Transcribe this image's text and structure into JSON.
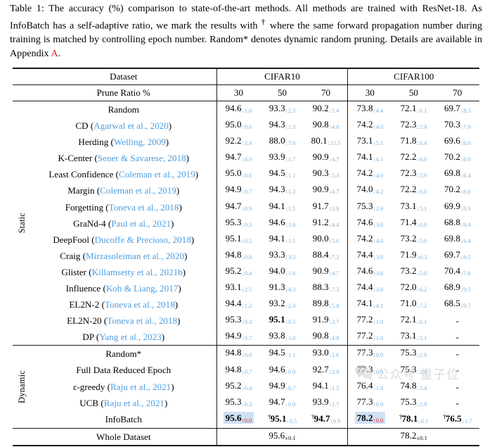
{
  "caption": {
    "label": "Table 1:",
    "text_1": " The accuracy (%) comparison to state-of-the-art methods. All methods are trained with ResNet-18. As InfoBatch has a self-adaptive ratio, we mark the results with ",
    "dagger": "†",
    "text_2": " where the same forward propagation number during training is matched by controlling epoch number. Random* denotes dynamic random pruning. Details are available in Appendix ",
    "appendix_link": "A",
    "text_3": "."
  },
  "table": {
    "header": {
      "dataset_label": "Dataset",
      "prune_ratio_label": "Prune Ratio %",
      "groups": [
        "CIFAR10",
        "CIFAR100"
      ],
      "ratios": [
        "30",
        "50",
        "70",
        "30",
        "50",
        "70"
      ]
    },
    "side_labels": {
      "static": "Static",
      "dynamic": "Dynamic"
    },
    "static_rows": [
      {
        "name": "Random",
        "cite": "",
        "year": "",
        "cells": [
          {
            "v": "94.6",
            "s": "↓1.0",
            "d": "down"
          },
          {
            "v": "93.3",
            "s": "↓2.3",
            "d": "down"
          },
          {
            "v": "90.2",
            "s": "↓5.4",
            "d": "down"
          },
          {
            "v": "73.8",
            "s": "↓4.4",
            "d": "down"
          },
          {
            "v": "72.1",
            "s": "↓6.1",
            "d": "down"
          },
          {
            "v": "69.7",
            "s": "↓8.5",
            "d": "down"
          }
        ]
      },
      {
        "name": "CD",
        "cite": "Agarwal et al., 2020",
        "year": "",
        "cells": [
          {
            "v": "95.0",
            "s": "↓0.6",
            "d": "down"
          },
          {
            "v": "94.3",
            "s": "↓1.3",
            "d": "down"
          },
          {
            "v": "90.8",
            "s": "↓4.8",
            "d": "down"
          },
          {
            "v": "74.2",
            "s": "↓4.0",
            "d": "down"
          },
          {
            "v": "72.3",
            "s": "↓5.9",
            "d": "down"
          },
          {
            "v": "70.3",
            "s": "↓7.9",
            "d": "down"
          }
        ]
      },
      {
        "name": "Herding",
        "cite": "Welling, 2009",
        "year": "",
        "cells": [
          {
            "v": "92.2",
            "s": "↓3.4",
            "d": "down"
          },
          {
            "v": "88.0",
            "s": "↓7.6",
            "d": "down"
          },
          {
            "v": "80.1",
            "s": "↓15.5",
            "d": "down"
          },
          {
            "v": "73.1",
            "s": "↓5.1",
            "d": "down"
          },
          {
            "v": "71.8",
            "s": "↓6.4",
            "d": "down"
          },
          {
            "v": "69.6",
            "s": "↓8.0",
            "d": "down"
          }
        ]
      },
      {
        "name": "K-Center",
        "cite": "Sener & Savarese, 2018",
        "year": "",
        "cells": [
          {
            "v": "94.7",
            "s": "↓0.9",
            "d": "down"
          },
          {
            "v": "93.9",
            "s": "↓1.7",
            "d": "down"
          },
          {
            "v": "90.9",
            "s": "↓4.7",
            "d": "down"
          },
          {
            "v": "74.1",
            "s": "↓4.1",
            "d": "down"
          },
          {
            "v": "72.2",
            "s": "↓6.0",
            "d": "down"
          },
          {
            "v": "70.2",
            "s": "↓8.0",
            "d": "down"
          }
        ]
      },
      {
        "name": "Least Confidence",
        "cite": "Coleman et al., 2019",
        "year": "",
        "cells": [
          {
            "v": "95.0",
            "s": "↓0.6",
            "d": "down"
          },
          {
            "v": "94.5",
            "s": "↓1.1",
            "d": "down"
          },
          {
            "v": "90.3",
            "s": "↓5.3",
            "d": "down"
          },
          {
            "v": "74.2",
            "s": "↓4.0",
            "d": "down"
          },
          {
            "v": "72.3",
            "s": "↓5.9",
            "d": "down"
          },
          {
            "v": "69.8",
            "s": "↓8.4",
            "d": "down"
          }
        ]
      },
      {
        "name": "Margin",
        "cite": "Coleman et al., 2019",
        "year": "",
        "cells": [
          {
            "v": "94.9",
            "s": "↓0.7",
            "d": "down"
          },
          {
            "v": "94.3",
            "s": "↓1.3",
            "d": "down"
          },
          {
            "v": "90.9",
            "s": "↓4.7",
            "d": "down"
          },
          {
            "v": "74.0",
            "s": "↓4.2",
            "d": "down"
          },
          {
            "v": "72.2",
            "s": "↓6.0",
            "d": "down"
          },
          {
            "v": "70.2",
            "s": "↓8.0",
            "d": "down"
          }
        ]
      },
      {
        "name": "Forgetting",
        "cite": "Toneva et al., 2018",
        "year": "",
        "cells": [
          {
            "v": "94.7",
            "s": "↓0.9",
            "d": "down"
          },
          {
            "v": "94.1",
            "s": "↓1.5",
            "d": "down"
          },
          {
            "v": "91.7",
            "s": "↓3.9",
            "d": "down"
          },
          {
            "v": "75.3",
            "s": "↓2.9",
            "d": "down"
          },
          {
            "v": "73.1",
            "s": "↓5.1",
            "d": "down"
          },
          {
            "v": "69.9",
            "s": "↓8.3",
            "d": "down"
          }
        ]
      },
      {
        "name": "GraNd-4",
        "cite": "Paul et al., 2021",
        "year": "",
        "cells": [
          {
            "v": "95.3",
            "s": "↓0.3",
            "d": "down"
          },
          {
            "v": "94.6",
            "s": "↓1.0",
            "d": "down"
          },
          {
            "v": "91.2",
            "s": "↓4.4",
            "d": "down"
          },
          {
            "v": "74.6",
            "s": "↓3.6",
            "d": "down"
          },
          {
            "v": "71.4",
            "s": "↓6.8",
            "d": "down"
          },
          {
            "v": "68.8",
            "s": "↓9.4",
            "d": "down"
          }
        ]
      },
      {
        "name": "DeepFool",
        "cite": "Ducoffe & Precioso, 2018",
        "year": "",
        "cells": [
          {
            "v": "95.1",
            "s": "↓0.5",
            "d": "down"
          },
          {
            "v": "94.1",
            "s": "↓1.5",
            "d": "down"
          },
          {
            "v": "90.0",
            "s": "↓5.6",
            "d": "down"
          },
          {
            "v": "74.2",
            "s": "↓4.0",
            "d": "down"
          },
          {
            "v": "73.2",
            "s": "↓5.0",
            "d": "down"
          },
          {
            "v": "69.8",
            "s": "↓6.4",
            "d": "down"
          }
        ]
      },
      {
        "name": "Craig",
        "cite": "Mirzasoleiman et al., 2020",
        "year": "",
        "cells": [
          {
            "v": "94.8",
            "s": "↓0.8",
            "d": "down"
          },
          {
            "v": "93.3",
            "s": "↓3.3",
            "d": "down"
          },
          {
            "v": "88.4",
            "s": "↓7.2",
            "d": "down"
          },
          {
            "v": "74.4",
            "s": "↓3.8",
            "d": "down"
          },
          {
            "v": "71.9",
            "s": "↓6.3",
            "d": "down"
          },
          {
            "v": "69.7",
            "s": "↓8.5",
            "d": "down"
          }
        ]
      },
      {
        "name": "Glister",
        "cite": "Killamsetty et al., 2021b",
        "year": "",
        "cells": [
          {
            "v": "95.2",
            "s": "↓0.4",
            "d": "down"
          },
          {
            "v": "94.0",
            "s": "↓1.6",
            "d": "down"
          },
          {
            "v": "90.9",
            "s": "↓4.7",
            "d": "down"
          },
          {
            "v": "74.6",
            "s": "↓3.6",
            "d": "down"
          },
          {
            "v": "73.2",
            "s": "↓5.0",
            "d": "down"
          },
          {
            "v": "70.4",
            "s": "↓7.8",
            "d": "down"
          }
        ]
      },
      {
        "name": "Influence",
        "cite": "Koh & Liang, 2017",
        "year": "",
        "cells": [
          {
            "v": "93.1",
            "s": "↓2.5",
            "d": "down"
          },
          {
            "v": "91.3",
            "s": "↓4.3",
            "d": "down"
          },
          {
            "v": "88.3",
            "s": "↓7.3",
            "d": "down"
          },
          {
            "v": "74.4",
            "s": "↓3.8",
            "d": "down"
          },
          {
            "v": "72.0",
            "s": "↓6.2",
            "d": "down"
          },
          {
            "v": "68.9",
            "s": "↓9.5",
            "d": "down"
          }
        ]
      },
      {
        "name": "EL2N-2",
        "cite": "Toneva et al., 2018",
        "year": "",
        "cells": [
          {
            "v": "94.4",
            "s": "↓1.2",
            "d": "down"
          },
          {
            "v": "93.2",
            "s": "↓2.4",
            "d": "down"
          },
          {
            "v": "89.8",
            "s": "↓5.8",
            "d": "down"
          },
          {
            "v": "74.1",
            "s": "↓4.1",
            "d": "down"
          },
          {
            "v": "71.0",
            "s": "↓7.2",
            "d": "down"
          },
          {
            "v": "68.5",
            "s": "↓9.7",
            "d": "down"
          }
        ]
      },
      {
        "name": "EL2N-20",
        "cite": "Toneva et al., 2018",
        "year": "",
        "cells": [
          {
            "v": "95.3",
            "s": "↓0.3",
            "d": "down"
          },
          {
            "v": "95.1",
            "s": "↓0.5",
            "d": "down",
            "bold": true
          },
          {
            "v": "91.9",
            "s": "↓3.7",
            "d": "down"
          },
          {
            "v": "77.2",
            "s": "↓1.0",
            "d": "down"
          },
          {
            "v": "72.1",
            "s": "↓6.1",
            "d": "down"
          },
          {
            "v": "-",
            "s": "",
            "d": "none"
          }
        ]
      },
      {
        "name": "DP",
        "cite": "Yang et al., 2023",
        "year": "",
        "cells": [
          {
            "v": "94.9",
            "s": "↓0.7",
            "d": "down"
          },
          {
            "v": "93.8",
            "s": "↓1.8",
            "d": "down"
          },
          {
            "v": "90.8",
            "s": "↓4.8",
            "d": "down"
          },
          {
            "v": "77.2",
            "s": "↓1.0",
            "d": "down"
          },
          {
            "v": "73.1",
            "s": "↓5.1",
            "d": "down"
          },
          {
            "v": "-",
            "s": "",
            "d": "none"
          }
        ]
      }
    ],
    "dynamic_rows": [
      {
        "name": "Random*",
        "cite": "",
        "year": "",
        "cells": [
          {
            "v": "94.8",
            "s": "↓0.8",
            "d": "down"
          },
          {
            "v": "94.5",
            "s": "↓1.1",
            "d": "down"
          },
          {
            "v": "93.0",
            "s": "↓2.6",
            "d": "down"
          },
          {
            "v": "77.3",
            "s": "↓0.9",
            "d": "down"
          },
          {
            "v": "75.3",
            "s": "↓2.9",
            "d": "down"
          },
          {
            "v": "-",
            "s": "",
            "d": "none"
          }
        ]
      },
      {
        "name": "Full Data Reduced Epoch",
        "cite": "",
        "year": "",
        "cells": [
          {
            "v": "94.8",
            "s": "↓0.7",
            "d": "down"
          },
          {
            "v": "94.6",
            "s": "↓0.9",
            "d": "down"
          },
          {
            "v": "92.7",
            "s": "↓2.9",
            "d": "down"
          },
          {
            "v": "77.3",
            "s": "↓0.9",
            "d": "down"
          },
          {
            "v": "75.3",
            "s": "↓2.9",
            "d": "down"
          },
          {
            "v": "-",
            "s": "",
            "d": "none"
          }
        ]
      },
      {
        "name": "ε-greedy",
        "cite": "Raju et al., 2021",
        "year": "",
        "cells": [
          {
            "v": "95.2",
            "s": "↓0.4",
            "d": "down"
          },
          {
            "v": "94.9",
            "s": "↓0.7",
            "d": "down"
          },
          {
            "v": "94.1",
            "s": "↓1.5",
            "d": "down"
          },
          {
            "v": "76.4",
            "s": "↓1.8",
            "d": "down"
          },
          {
            "v": "74.8",
            "s": "↓3.4",
            "d": "down"
          },
          {
            "v": "-",
            "s": "",
            "d": "none"
          }
        ]
      },
      {
        "name": "UCB",
        "cite": "Raju et al., 2021",
        "year": "",
        "cells": [
          {
            "v": "95.3",
            "s": "↓0.3",
            "d": "down"
          },
          {
            "v": "94.7",
            "s": "↓0.9",
            "d": "down"
          },
          {
            "v": "93.9",
            "s": "↓1.7",
            "d": "down"
          },
          {
            "v": "77.3",
            "s": "↓0.9",
            "d": "down"
          },
          {
            "v": "75.3",
            "s": "↓2.9",
            "d": "down"
          },
          {
            "v": "-",
            "s": "",
            "d": "none"
          }
        ]
      }
    ],
    "infobatch_row": {
      "name": "InfoBatch",
      "cite": "",
      "year": "",
      "cells": [
        {
          "v": "95.6",
          "s": "↑0.0",
          "d": "up",
          "bold": true,
          "hl": true
        },
        {
          "v": "95.1",
          "s": "↓0.5",
          "d": "down",
          "bold": true,
          "dag": true
        },
        {
          "v": "94.7",
          "s": "↓0.9",
          "d": "down",
          "bold": true,
          "dag": true
        },
        {
          "v": "78.2",
          "s": "↑0.0",
          "d": "up",
          "bold": true,
          "hl": true
        },
        {
          "v": "78.1",
          "s": "↓0.1",
          "d": "down",
          "bold": true,
          "dag": true
        },
        {
          "v": "76.5",
          "s": "↓1.7",
          "d": "down",
          "bold": true,
          "dag": true
        }
      ]
    },
    "whole_dataset_row": {
      "name": "Whole Dataset",
      "cifar10": {
        "value": "95.6",
        "sub": "±0.1"
      },
      "cifar100": {
        "value": "78.2",
        "sub": "±0.1"
      }
    }
  },
  "watermark": {
    "text": "公众号 量子位",
    "icon": "wechat-icon"
  },
  "colors": {
    "citation_blue": "#4d9de0",
    "down_sub_blue": "#7fb3dd",
    "up_sub_red": "#e03030",
    "highlight": "#cfe0f5",
    "appendix_red": "#d11a2a"
  }
}
